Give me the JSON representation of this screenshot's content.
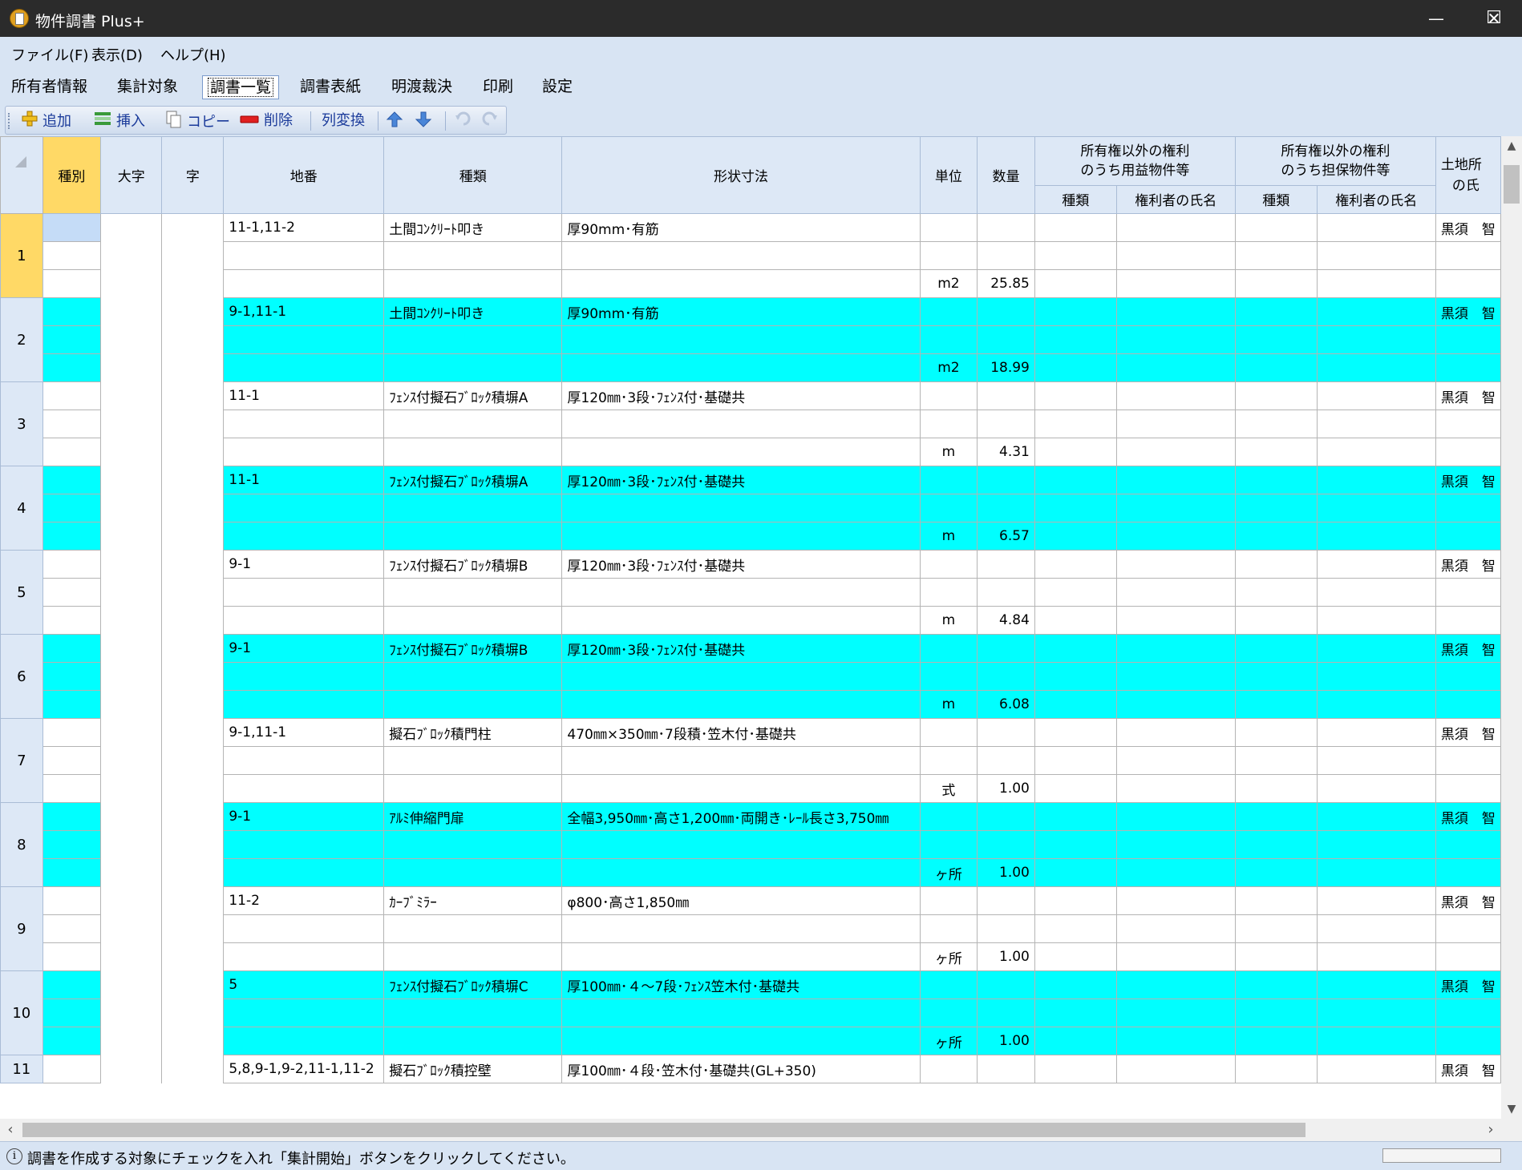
{
  "window": {
    "title": "物件調書 Plus+",
    "minimize_glyph": "—",
    "maximize_glyph": "☐",
    "close_glyph": "✕"
  },
  "menu": [
    "ファイル(F)",
    "表示(D)",
    "ヘルプ(H)"
  ],
  "tabs": [
    "所有者情報",
    "集計対象",
    "調書一覧",
    "調書表紙",
    "明渡裁決",
    "印刷",
    "設定"
  ],
  "active_tab": "調書一覧",
  "toolbar": {
    "add": "追加",
    "insert": "挿入",
    "copy": "コピー",
    "delete": "削除",
    "convert": "列変換"
  },
  "grid": {
    "headers": {
      "kind": "種別",
      "oaza": "大字",
      "aza": "字",
      "chiban": "地番",
      "shurui": "種類",
      "shape": "形状寸法",
      "unit": "単位",
      "qty": "数量",
      "usufruct_group_line1": "所有権以外の権利",
      "usufruct_group_line2": "のうち用益物件等",
      "security_group_line1": "所有権以外の権利",
      "security_group_line2": "のうち担保物件等",
      "sub_kind": "種類",
      "sub_holder": "権利者の氏名",
      "land_owner_line1": "土地所",
      "land_owner_line2": "の氏"
    },
    "rows": [
      {
        "no": "1",
        "chiban": "11-1,11-2",
        "shurui": "土間ｺﾝｸﾘｰﾄ叩き",
        "shape": "厚90mm･有筋",
        "unit": "m2",
        "qty": "25.85",
        "owner": "黒須　智"
      },
      {
        "no": "2",
        "chiban": "9-1,11-1",
        "shurui": "土間ｺﾝｸﾘｰﾄ叩き",
        "shape": "厚90mm･有筋",
        "unit": "m2",
        "qty": "18.99",
        "owner": "黒須　智"
      },
      {
        "no": "3",
        "chiban": "11-1",
        "shurui": "ﾌｪﾝｽ付擬石ﾌﾞﾛｯｸ積塀A",
        "shape": "厚120㎜･3段･ﾌｪﾝｽ付･基礎共",
        "unit": "m",
        "qty": "4.31",
        "owner": "黒須　智"
      },
      {
        "no": "4",
        "chiban": "11-1",
        "shurui": "ﾌｪﾝｽ付擬石ﾌﾞﾛｯｸ積塀A",
        "shape": "厚120㎜･3段･ﾌｪﾝｽ付･基礎共",
        "unit": "m",
        "qty": "6.57",
        "owner": "黒須　智"
      },
      {
        "no": "5",
        "chiban": "9-1",
        "shurui": "ﾌｪﾝｽ付擬石ﾌﾞﾛｯｸ積塀B",
        "shape": "厚120㎜･3段･ﾌｪﾝｽ付･基礎共",
        "unit": "m",
        "qty": "4.84",
        "owner": "黒須　智"
      },
      {
        "no": "6",
        "chiban": "9-1",
        "shurui": "ﾌｪﾝｽ付擬石ﾌﾞﾛｯｸ積塀B",
        "shape": "厚120㎜･3段･ﾌｪﾝｽ付･基礎共",
        "unit": "m",
        "qty": "6.08",
        "owner": "黒須　智"
      },
      {
        "no": "7",
        "chiban": "9-1,11-1",
        "shurui": "擬石ﾌﾞﾛｯｸ積門柱",
        "shape": "470㎜×350㎜･7段積･笠木付･基礎共",
        "unit": "式",
        "qty": "1.00",
        "owner": "黒須　智"
      },
      {
        "no": "8",
        "chiban": "9-1",
        "shurui": "ｱﾙﾐ伸縮門扉",
        "shape": "全幅3,950㎜･高さ1,200㎜･両開き･ﾚｰﾙ長さ3,750㎜",
        "unit": "ヶ所",
        "qty": "1.00",
        "owner": "黒須　智"
      },
      {
        "no": "9",
        "chiban": "11-2",
        "shurui": "ｶｰﾌﾞﾐﾗｰ",
        "shape": "φ800･高さ1,850㎜",
        "unit": "ヶ所",
        "qty": "1.00",
        "owner": "黒須　智"
      },
      {
        "no": "10",
        "chiban": "5",
        "shurui": "ﾌｪﾝｽ付擬石ﾌﾞﾛｯｸ積塀C",
        "shape": "厚100㎜･４～7段･ﾌｪﾝｽ笠木付･基礎共",
        "unit": "ヶ所",
        "qty": "1.00",
        "owner": "黒須　智"
      },
      {
        "no": "11",
        "chiban": "5,8,9-1,9-2,11-1,11-2",
        "shurui": "擬石ﾌﾞﾛｯｸ積控壁",
        "shape": "厚100㎜･４段･笠木付･基礎共(GL+350)",
        "unit": "",
        "qty": "",
        "owner": "黒須　智"
      }
    ]
  },
  "status": {
    "message": "調書を作成する対象にチェックを入れ「集計開始」ボタンをクリックしてください。"
  },
  "colors": {
    "cyan_row": "#00ffff",
    "selected_header": "#ffd966",
    "header_bg": "#dde8f6",
    "titlebar": "#2b2b2b"
  }
}
